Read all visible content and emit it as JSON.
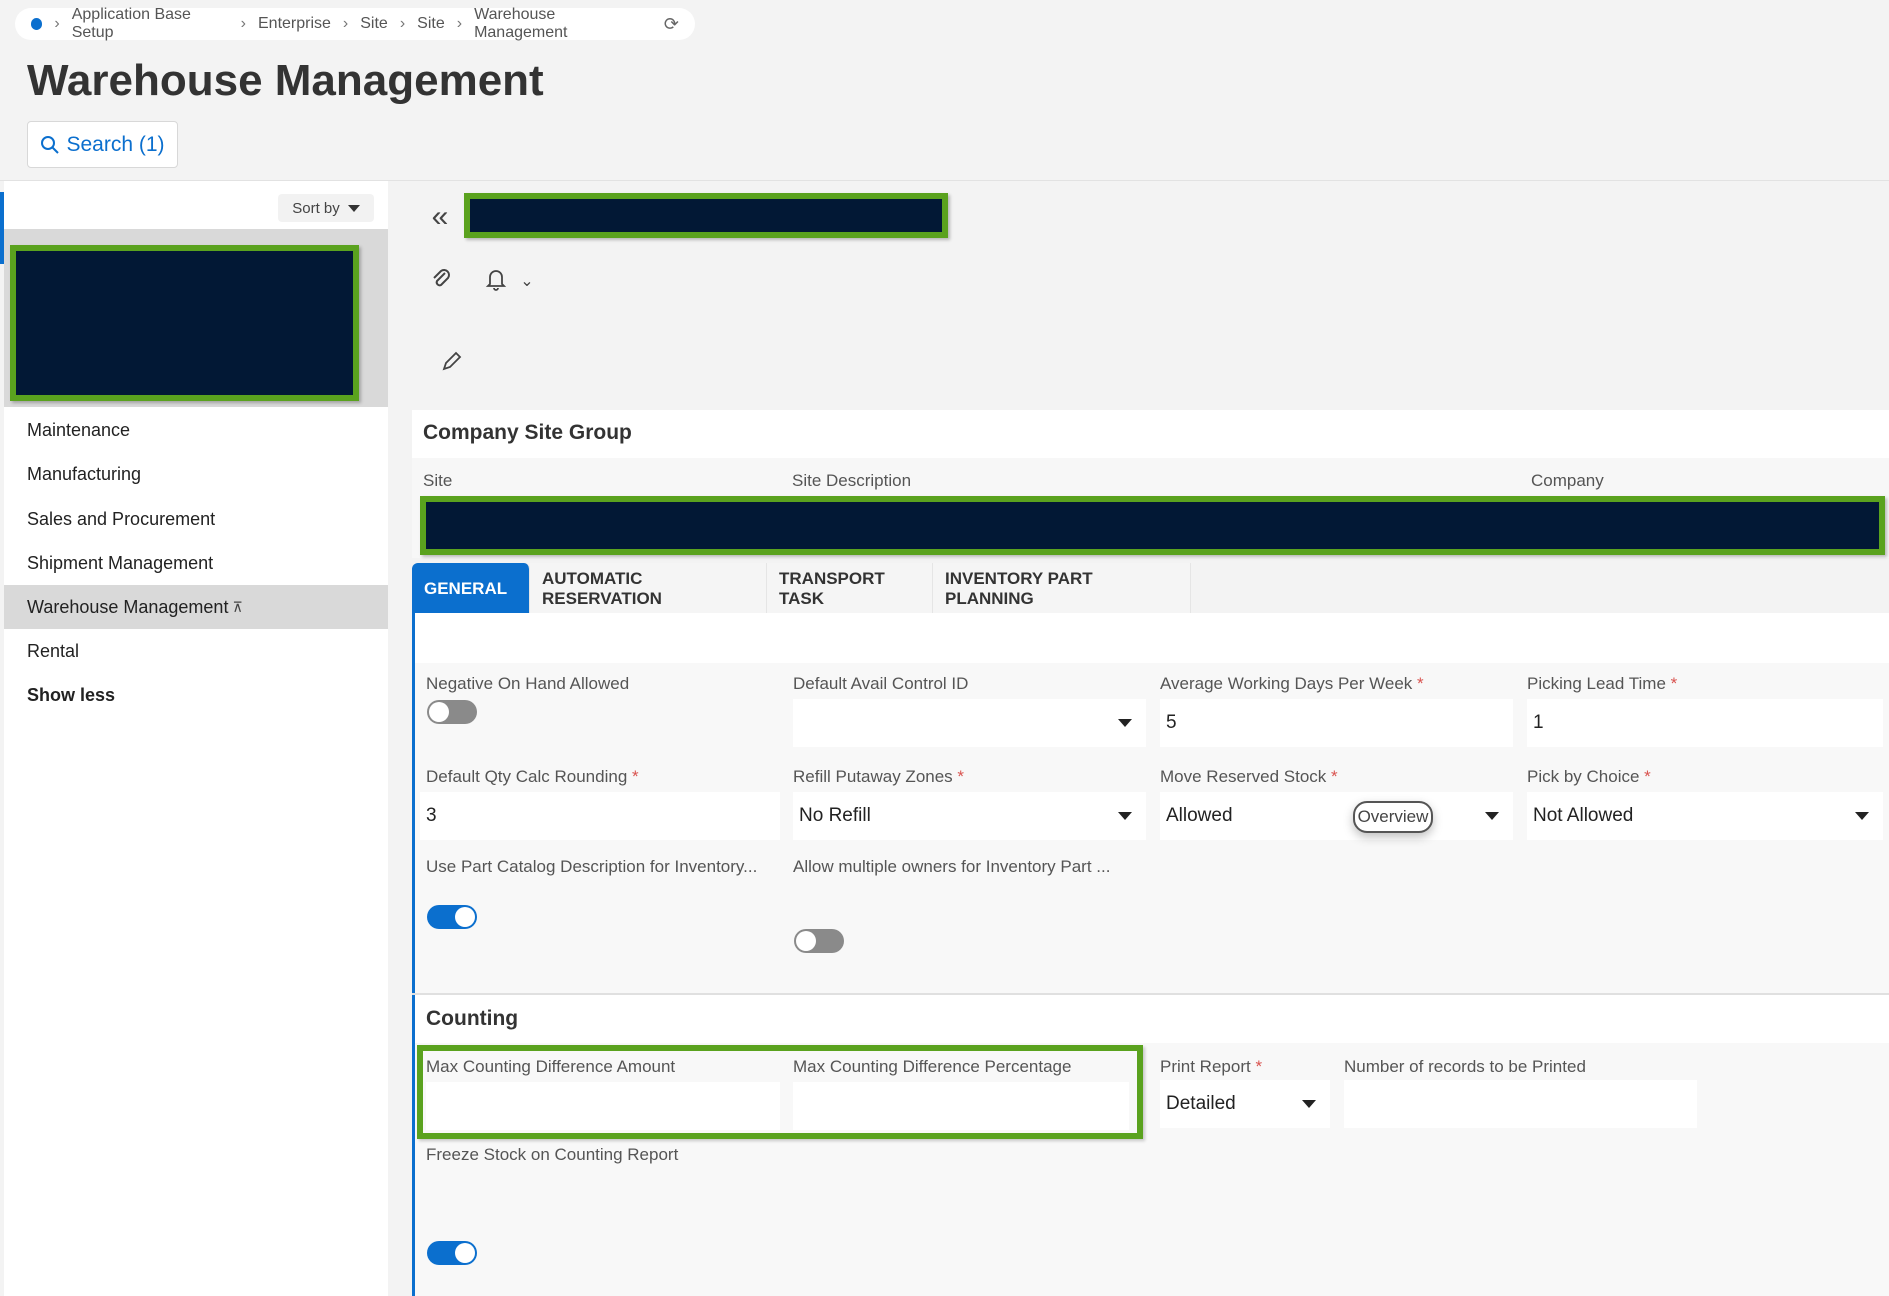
{
  "breadcrumb": {
    "items": [
      "Application Base Setup",
      "Enterprise",
      "Site",
      "Site",
      "Warehouse Management"
    ]
  },
  "page": {
    "title": "Warehouse Management"
  },
  "search": {
    "label": "Search (1)"
  },
  "nav": {
    "sort_label": "Sort by",
    "items": [
      {
        "label": "Maintenance"
      },
      {
        "label": "Manufacturing"
      },
      {
        "label": "Sales and Procurement"
      },
      {
        "label": "Shipment Management"
      },
      {
        "label": "Warehouse Management"
      },
      {
        "label": "Rental"
      }
    ],
    "show_less": "Show less"
  },
  "company_site_group": {
    "title": "Company Site Group",
    "columns": [
      "Site",
      "Site Description",
      "Company"
    ]
  },
  "tabs": [
    {
      "label": "GENERAL"
    },
    {
      "label": "AUTOMATIC RESERVATION"
    },
    {
      "label": "TRANSPORT TASK"
    },
    {
      "label": "INVENTORY PART PLANNING"
    }
  ],
  "general": {
    "negative_on_hand": {
      "label": "Negative On Hand Allowed",
      "on": false
    },
    "default_avail_control": {
      "label": "Default Avail Control ID",
      "value": ""
    },
    "avg_working_days": {
      "label": "Average Working Days Per Week",
      "value": "5"
    },
    "picking_lead_time": {
      "label": "Picking Lead Time",
      "value": "1"
    },
    "default_qty_calc": {
      "label": "Default Qty Calc Rounding",
      "value": "3"
    },
    "refill_putaway": {
      "label": "Refill Putaway Zones",
      "value": "No Refill"
    },
    "move_reserved_stock": {
      "label": "Move Reserved Stock",
      "value": "Allowed"
    },
    "pick_by_choice": {
      "label": "Pick by Choice",
      "value": "Not Allowed"
    },
    "use_part_catalog": {
      "label": "Use Part Catalog Description for Inventory...",
      "on": true
    },
    "allow_multiple_owners": {
      "label": "Allow multiple owners for Inventory Part ...",
      "on": false
    },
    "overview_label": "Overview"
  },
  "counting": {
    "title": "Counting",
    "max_diff_amount": {
      "label": "Max Counting Difference Amount",
      "value": ""
    },
    "max_diff_pct": {
      "label": "Max Counting Difference Percentage",
      "value": ""
    },
    "print_report": {
      "label": "Print Report",
      "value": "Detailed"
    },
    "num_records": {
      "label": "Number of records to be Printed",
      "value": ""
    },
    "freeze_stock": {
      "label": "Freeze Stock on Counting Report",
      "on": true
    }
  },
  "required_marker": "*"
}
